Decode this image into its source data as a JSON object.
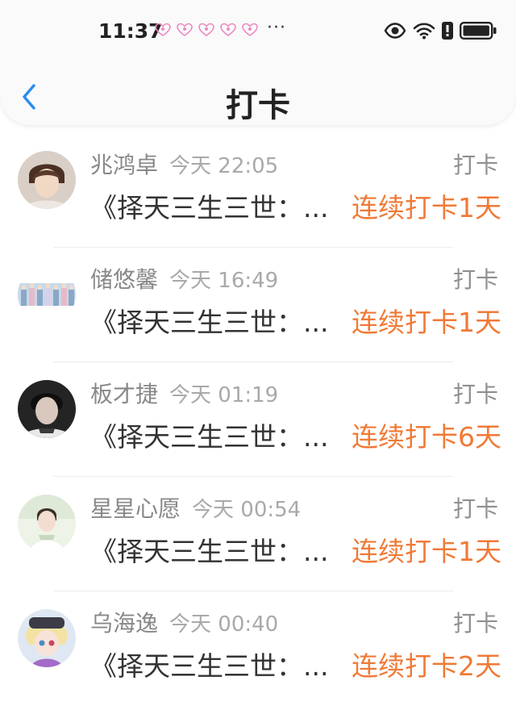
{
  "status_bar": {
    "time": "11:37",
    "dots": "···"
  },
  "nav": {
    "title": "打卡"
  },
  "colors": {
    "accent": "#f07a37",
    "back_icon": "#2a8cf0",
    "heart": "#ee88c2"
  },
  "items": [
    {
      "name": "兆鸿卓",
      "time": "今天 22:05",
      "tag": "打卡",
      "content": "《择天三生三世：...",
      "streak": "连续打卡1天"
    },
    {
      "name": "储悠馨",
      "time": "今天 16:49",
      "tag": "打卡",
      "content": "《择天三生三世：...",
      "streak": "连续打卡1天"
    },
    {
      "name": "板才捷",
      "time": "今天 01:19",
      "tag": "打卡",
      "content": "《择天三生三世：...",
      "streak": "连续打卡6天"
    },
    {
      "name": "星星心愿",
      "time": "今天 00:54",
      "tag": "打卡",
      "content": "《择天三生三世：...",
      "streak": "连续打卡1天"
    },
    {
      "name": "乌海逸",
      "time": "今天 00:40",
      "tag": "打卡",
      "content": "《择天三生三世：...",
      "streak": "连续打卡2天"
    }
  ]
}
